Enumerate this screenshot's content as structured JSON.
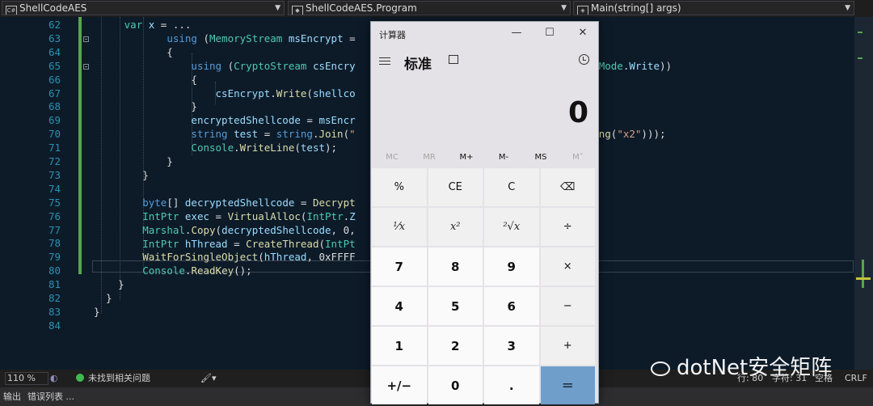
{
  "navbar": {
    "project": "ShellCodeAES",
    "class": "ShellCodeAES.Program",
    "method": "Main(string[] args)",
    "project_icon": "csharp-project-icon",
    "class_icon": "class-icon",
    "method_icon": "method-icon"
  },
  "editor": {
    "line_numbers": [
      "62",
      "63",
      "64",
      "65",
      "66",
      "67",
      "68",
      "69",
      "70",
      "71",
      "72",
      "73",
      "74",
      "75",
      "76",
      "77",
      "78",
      "79",
      "80",
      "81",
      "82",
      "83",
      "84"
    ]
  },
  "status": {
    "zoom": "110 %",
    "issues": "未找到相关问题",
    "line": "行: 80",
    "char": "字符: 31",
    "space": "空格",
    "eol": "CRLF"
  },
  "tabs": {
    "output": "输出",
    "errors": "错误列表 ..."
  },
  "calculator": {
    "title": "计算器",
    "mode": "标准",
    "display": "0",
    "memory": [
      "MC",
      "MR",
      "M+",
      "M-",
      "MS",
      "M˅"
    ],
    "keys": [
      [
        "%",
        "CE",
        "C",
        "⌫"
      ],
      [
        "⅟x",
        "x²",
        "²√x",
        "÷"
      ],
      [
        "7",
        "8",
        "9",
        "×"
      ],
      [
        "4",
        "5",
        "6",
        "−"
      ],
      [
        "1",
        "2",
        "3",
        "+"
      ],
      [
        "+/−",
        "0",
        ".",
        "="
      ]
    ]
  },
  "watermark": {
    "text": "dotNet安全矩阵"
  }
}
